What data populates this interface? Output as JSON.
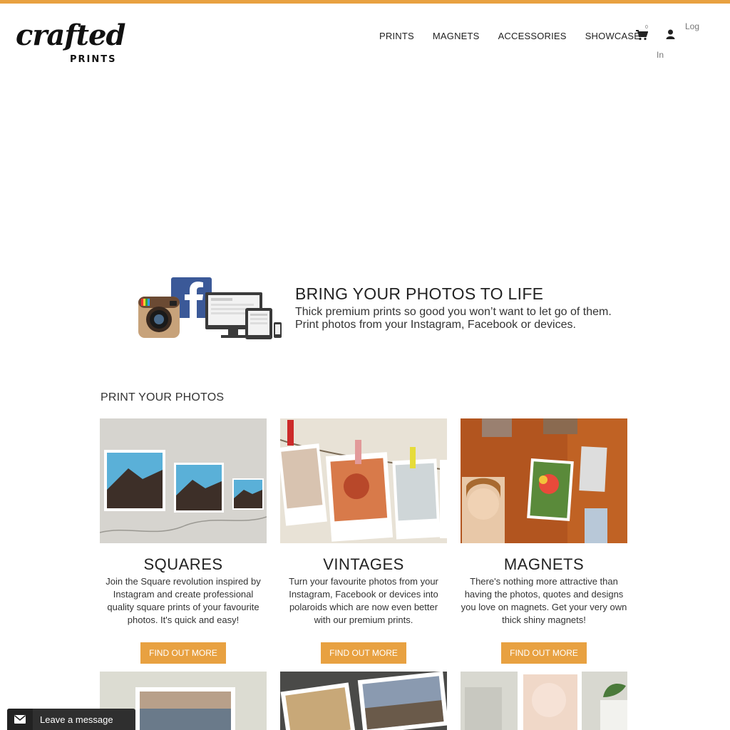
{
  "brand": {
    "logo_script": "crafted",
    "logo_sub": "PRINTS",
    "accent": "#e8a141"
  },
  "nav": {
    "items": [
      {
        "label": "PRINTS"
      },
      {
        "label": "MAGNETS"
      },
      {
        "label": "ACCESSORIES"
      },
      {
        "label": "SHOWCASE"
      }
    ],
    "cart_icon": "cart-icon",
    "cart_count": "0",
    "user_icon": "user-icon",
    "login_top": "Log",
    "login_bottom": "In"
  },
  "promo": {
    "title": "BRING YOUR PHOTOS TO LIFE",
    "line1": "Thick premium prints so good you won’t want to let go of them.",
    "line2": "Print photos from your Instagram, Facebook or devices."
  },
  "section": {
    "title": "PRINT YOUR PHOTOS"
  },
  "cards": [
    {
      "title": "SQUARES",
      "desc": "Join the Square revolution inspired by Instagram and create professional quality square prints of your favourite photos. It's quick and easy!",
      "button": "FIND OUT MORE"
    },
    {
      "title": "VINTAGES",
      "desc": "Turn your favourite photos from your Instagram, Facebook or devices into polaroids which are now even better with our premium prints.",
      "button": "FIND OUT MORE"
    },
    {
      "title": "MAGNETS",
      "desc": "There's nothing more attractive than having the photos, quotes and designs you love on magnets. Get your very own thick shiny magnets!",
      "button": "FIND OUT MORE"
    }
  ],
  "chat": {
    "icon": "envelope-icon",
    "label": "Leave a message"
  }
}
